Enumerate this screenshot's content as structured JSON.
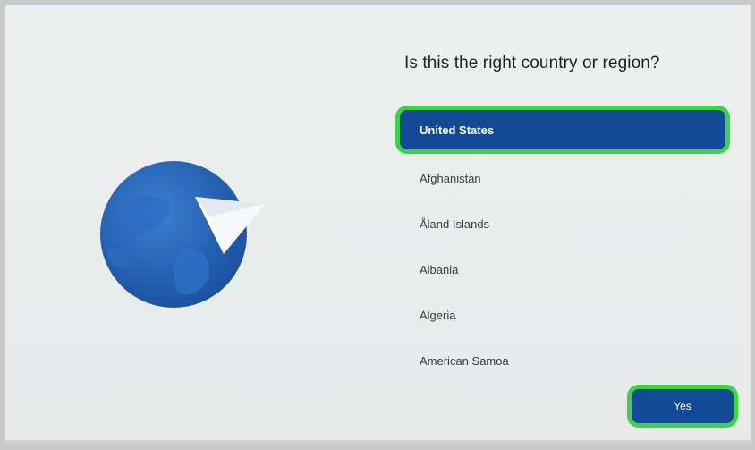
{
  "window": {
    "question": "Is this the right country or region?"
  },
  "country_list": {
    "items": [
      {
        "label": "United States",
        "selected": true
      },
      {
        "label": "Afghanistan",
        "selected": false
      },
      {
        "label": "Åland Islands",
        "selected": false
      },
      {
        "label": "Albania",
        "selected": false
      },
      {
        "label": "Algeria",
        "selected": false
      },
      {
        "label": "American Samoa",
        "selected": false
      }
    ]
  },
  "actions": {
    "yes_label": "Yes"
  },
  "icons": {
    "illustration": "globe-with-paper-plane-icon"
  },
  "colors": {
    "accent": "#124a96",
    "highlight_ring": "#3fd14a",
    "background": "#ecedee"
  }
}
